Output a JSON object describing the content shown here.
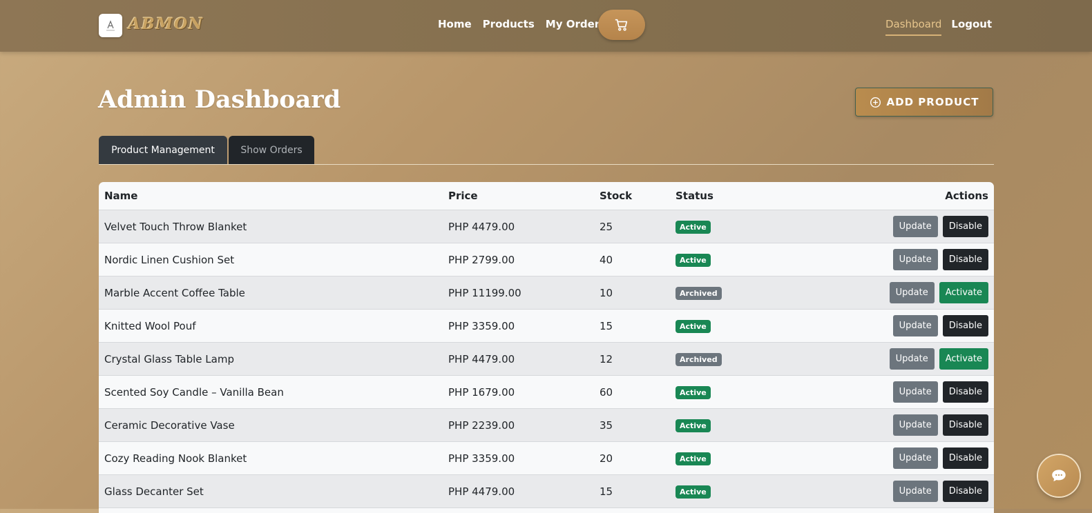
{
  "brand": {
    "name": "ABMON"
  },
  "nav": {
    "links": [
      "Home",
      "Products",
      "My Orders"
    ],
    "dashboard": "Dashboard",
    "logout": "Logout"
  },
  "page": {
    "title": "Admin Dashboard",
    "add_product_label": "ADD PRODUCT"
  },
  "tabs": [
    "Product Management",
    "Show Orders"
  ],
  "table": {
    "headers": {
      "name": "Name",
      "price": "Price",
      "stock": "Stock",
      "status": "Status",
      "actions": "Actions"
    },
    "rows": [
      {
        "name": "Velvet Touch Throw Blanket",
        "price": "PHP 4479.00",
        "stock": "25",
        "status": "Active",
        "update": "Update",
        "toggle": "Disable"
      },
      {
        "name": "Nordic Linen Cushion Set",
        "price": "PHP 2799.00",
        "stock": "40",
        "status": "Active",
        "update": "Update",
        "toggle": "Disable"
      },
      {
        "name": "Marble Accent Coffee Table",
        "price": "PHP 11199.00",
        "stock": "10",
        "status": "Archived",
        "update": "Update",
        "toggle": "Activate"
      },
      {
        "name": "Knitted Wool Pouf",
        "price": "PHP 3359.00",
        "stock": "15",
        "status": "Active",
        "update": "Update",
        "toggle": "Disable"
      },
      {
        "name": "Crystal Glass Table Lamp",
        "price": "PHP 4479.00",
        "stock": "12",
        "status": "Archived",
        "update": "Update",
        "toggle": "Activate"
      },
      {
        "name": "Scented Soy Candle – Vanilla Bean",
        "price": "PHP 1679.00",
        "stock": "60",
        "status": "Active",
        "update": "Update",
        "toggle": "Disable"
      },
      {
        "name": "Ceramic Decorative Vase",
        "price": "PHP 2239.00",
        "stock": "35",
        "status": "Active",
        "update": "Update",
        "toggle": "Disable"
      },
      {
        "name": "Cozy Reading Nook Blanket",
        "price": "PHP 3359.00",
        "stock": "20",
        "status": "Active",
        "update": "Update",
        "toggle": "Disable"
      },
      {
        "name": "Glass Decanter Set",
        "price": "PHP 4479.00",
        "stock": "15",
        "status": "Active",
        "update": "Update",
        "toggle": "Disable"
      }
    ]
  },
  "icons": {
    "cart": "cart-icon",
    "add": "plus-circle-icon",
    "chat": "chat-icon"
  },
  "colors": {
    "active": "#198754",
    "archived": "#6c757d",
    "accent": "#b98c4e"
  }
}
